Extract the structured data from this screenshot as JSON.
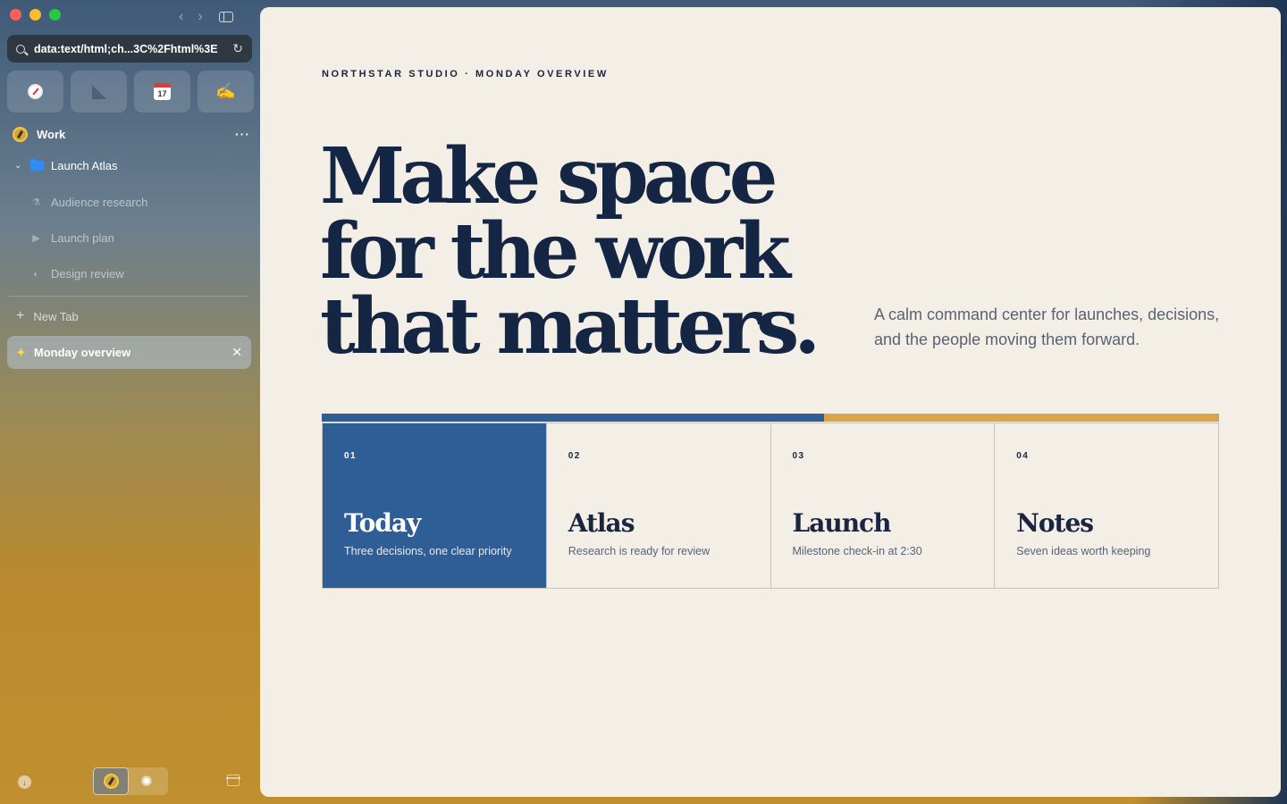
{
  "browser": {
    "url": "data:text/html;ch...3C%2Fhtml%3E",
    "space_name": "Work",
    "space_more": "···",
    "folder": {
      "name": "Launch Atlas",
      "items": [
        {
          "label": "Audience research"
        },
        {
          "label": "Launch plan"
        },
        {
          "label": "Design review"
        }
      ]
    },
    "new_tab_label": "New Tab",
    "active_tab_label": "Monday overview",
    "calendar_day": "17"
  },
  "page": {
    "eyebrow": "NORTHSTAR STUDIO · MONDAY OVERVIEW",
    "headline": "Make space for the work that matters.",
    "tagline": "A calm command center for launches, decisions, and the people moving them forward.",
    "progress_fraction": 0.56,
    "colors": {
      "accent": "#2f5d96",
      "gold": "#d8a646",
      "ink": "#152544",
      "paper": "#f3efe6"
    },
    "cards": [
      {
        "num": "01",
        "title": "Today",
        "desc": "Three decisions, one clear priority",
        "active": true
      },
      {
        "num": "02",
        "title": "Atlas",
        "desc": "Research is ready for review",
        "active": false
      },
      {
        "num": "03",
        "title": "Launch",
        "desc": "Milestone check-in at 2:30",
        "active": false
      },
      {
        "num": "04",
        "title": "Notes",
        "desc": "Seven ideas worth keeping",
        "active": false
      }
    ]
  }
}
